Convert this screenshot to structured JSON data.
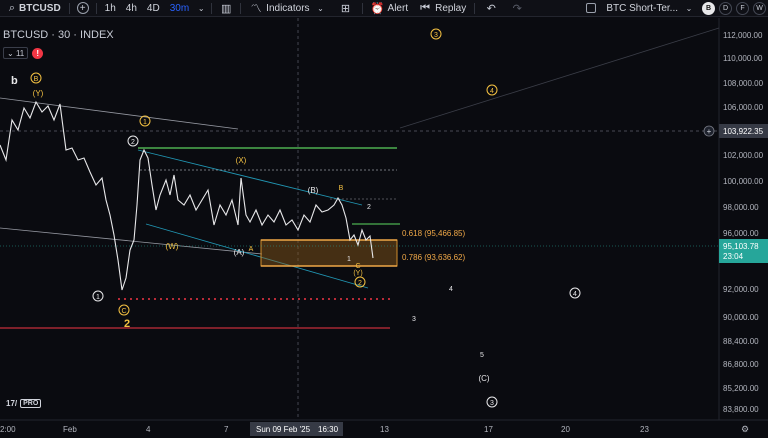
{
  "toolbar": {
    "symbol": "BTCUSD",
    "timeframes": [
      "1h",
      "4h",
      "4D",
      "30m"
    ],
    "active_timeframe": "30m",
    "indicators_label": "Indicators",
    "alert_label": "Alert",
    "replay_label": "Replay",
    "layout_name": "BTC Short-Ter...",
    "badges": [
      "B",
      "D",
      "F",
      "W"
    ],
    "active_badge": "B"
  },
  "legend": {
    "title": "BTCUSD · 30 · INDEX",
    "indicator_count": "11",
    "warning": "!"
  },
  "price_axis": {
    "labels": [
      "112,000.00",
      "110,000.00",
      "108,000.00",
      "106,000.00",
      "103,922.35",
      "102,000.00",
      "100,000.00",
      "98,000.00",
      "96,000.00",
      "95,103.78",
      "23:04",
      "92,000.00",
      "90,000.00",
      "88,400.00",
      "86,800.00",
      "85,200.00",
      "83,800.00"
    ],
    "crosshair_price": "103,922.35",
    "last_price": "95,103.78",
    "countdown": "23:04",
    "last_price_color": "#26a69a"
  },
  "time_axis": {
    "labels": [
      "2:00",
      "Feb",
      "4",
      "7",
      "13",
      "17",
      "20",
      "23"
    ],
    "crosshair_time": "Sun 09 Feb '25",
    "crosshair_clock": "16:30"
  },
  "fib": {
    "level_618": "0.618 (95,466.85)",
    "level_786": "0.786 (93,636.62)"
  },
  "wave_labels": {
    "b": "b",
    "B_circ": "B",
    "Y_paren": "(Y)",
    "one_circ_top": "1",
    "two_circ": "2",
    "X_paren": "(X)",
    "W_paren": "(W)",
    "A_paren": "(A)",
    "A": "A",
    "B_paren": "(B)",
    "B": "B",
    "two_small": "2",
    "one_small": "1",
    "C": "C",
    "Y_paren2": "(Y)",
    "two_circ_low": "2",
    "three_circ_top": "3",
    "four_circ_top": "4",
    "one_circ_low": "1",
    "C_circ": "C",
    "two_big": "2",
    "four_small": "4",
    "four_circ_right": "4",
    "three_small": "3",
    "five_small": "5",
    "C_paren": "(C)",
    "three_circ_bottom": "3"
  },
  "logo_text": "PRO"
}
